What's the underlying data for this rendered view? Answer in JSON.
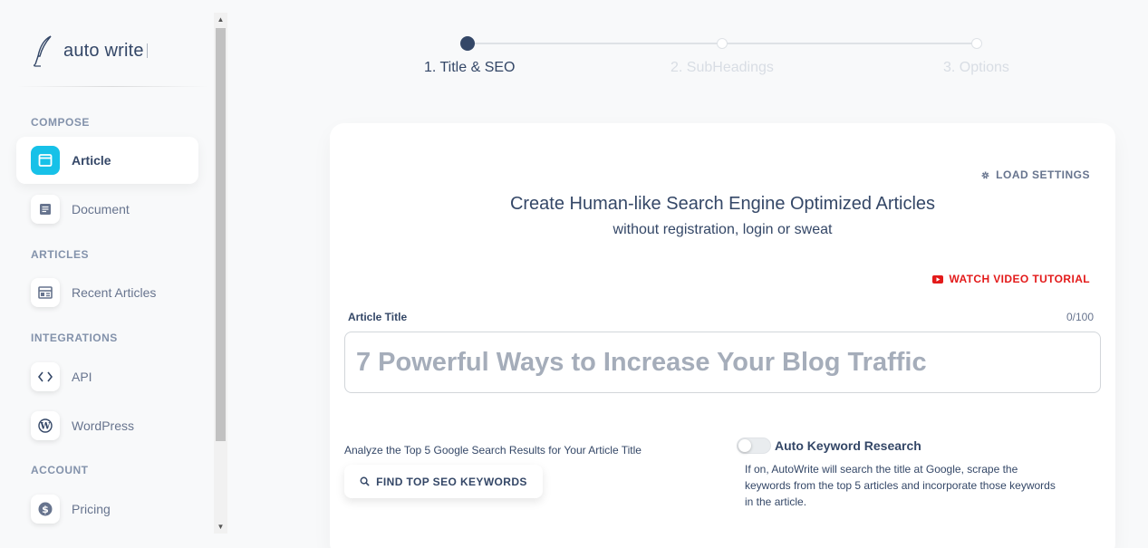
{
  "brand": {
    "name": "auto write",
    "icon": "quill-pen-icon"
  },
  "sidebar": {
    "sections": [
      {
        "label": "COMPOSE"
      },
      {
        "label": "ARTICLES"
      },
      {
        "label": "INTEGRATIONS"
      },
      {
        "label": "ACCOUNT"
      }
    ],
    "items": [
      {
        "label": "Article",
        "icon": "window-icon",
        "active": true
      },
      {
        "label": "Document",
        "icon": "document-icon"
      },
      {
        "label": "Recent Articles",
        "icon": "table-icon"
      },
      {
        "label": "API",
        "icon": "code-icon"
      },
      {
        "label": "WordPress",
        "icon": "wordpress-icon"
      },
      {
        "label": "Pricing",
        "icon": "dollar-icon"
      }
    ]
  },
  "stepper": {
    "steps": [
      {
        "label": "1. Title & SEO",
        "state": "active"
      },
      {
        "label": "2. SubHeadings",
        "state": "pending"
      },
      {
        "label": "3. Options",
        "state": "pending"
      }
    ]
  },
  "card": {
    "load_settings": "LOAD SETTINGS",
    "headline": "Create Human-like Search Engine Optimized Articles",
    "subline": "without registration, login or sweat",
    "watch_video": "WATCH VIDEO TUTORIAL",
    "article_title_label": "Article Title",
    "char_count": "0/100",
    "title_placeholder": "7 Powerful Ways to Increase Your Blog Traffic",
    "title_value": "",
    "analyze_text": "Analyze the Top 5 Google Search Results for Your Article Title",
    "find_button": "FIND TOP SEO KEYWORDS",
    "auto_keyword": {
      "label": "Auto Keyword Research",
      "enabled": false,
      "help": "If on, AutoWrite will search the title at Google, scrape the keywords from the top 5 articles and incorporate those keywords in the article."
    }
  },
  "colors": {
    "accent": "#17c1e8",
    "primary_text": "#344767",
    "muted_text": "#67748e",
    "danger": "#e31a1a"
  }
}
